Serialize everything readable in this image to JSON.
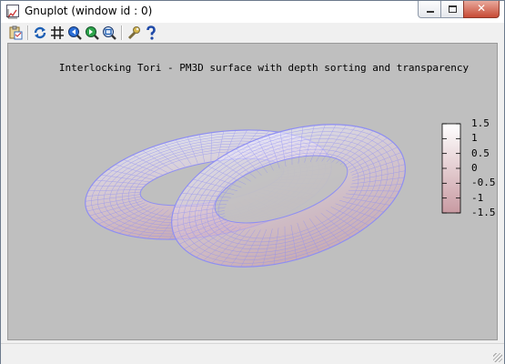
{
  "window": {
    "title": "Gnuplot (window id : 0)"
  },
  "title_bar_buttons": {
    "close": "✕"
  },
  "toolbar": {
    "items": [
      "copy-to-clipboard",
      "replot",
      "toggle-grid",
      "zoom-previous",
      "zoom-next",
      "unzoom",
      "options",
      "help"
    ]
  },
  "plot": {
    "title": "Interlocking Tori - PM3D surface with depth sorting and transparency",
    "background": "#bfbfbf",
    "colorbox": {
      "tick_labels": [
        "1.5",
        "1",
        "0.5",
        "0",
        "-0.5",
        "-1",
        "-1.5"
      ],
      "range": [
        -1.5,
        1.5
      ],
      "colors": {
        "top": "#ffffff",
        "bottom": "#c89aa2"
      }
    },
    "surface_colors": {
      "mesh": "#8f8ff2",
      "high": "#eeeeff",
      "low": "#cfa0ae"
    }
  }
}
